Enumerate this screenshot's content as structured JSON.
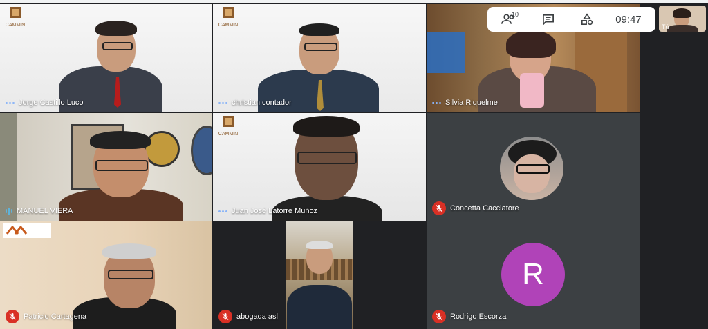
{
  "participants": [
    {
      "name": "Jorge Castillo Luco",
      "status": "talking"
    },
    {
      "name": "christian contador",
      "status": "talking"
    },
    {
      "name": "Silvia Riquelme",
      "status": "talking"
    },
    {
      "name": "MANUEL VIERA",
      "status": "speaking"
    },
    {
      "name": "Juan José Latorre Muñoz",
      "status": "talking"
    },
    {
      "name": "Concetta Cacciatore",
      "status": "muted"
    },
    {
      "name": "Patricio Cartagena",
      "status": "muted"
    },
    {
      "name": "abogada asl",
      "status": "muted"
    },
    {
      "name": "Rodrigo Escorza",
      "status": "muted",
      "initial": "R",
      "avatar_color": "#b043b8"
    }
  ],
  "logo": {
    "text": "CAMMIN"
  },
  "toolbar": {
    "people_count": "10",
    "time": "09:47",
    "people_icon": "people-icon",
    "chat_icon": "chat-icon",
    "activities_icon": "activities-icon"
  },
  "self_view": {
    "label": "Tú"
  },
  "colors": {
    "background": "#202124",
    "mic_off": "#d93025",
    "active_dots": "#8ab4f8",
    "avatar_purple": "#b043b8"
  }
}
